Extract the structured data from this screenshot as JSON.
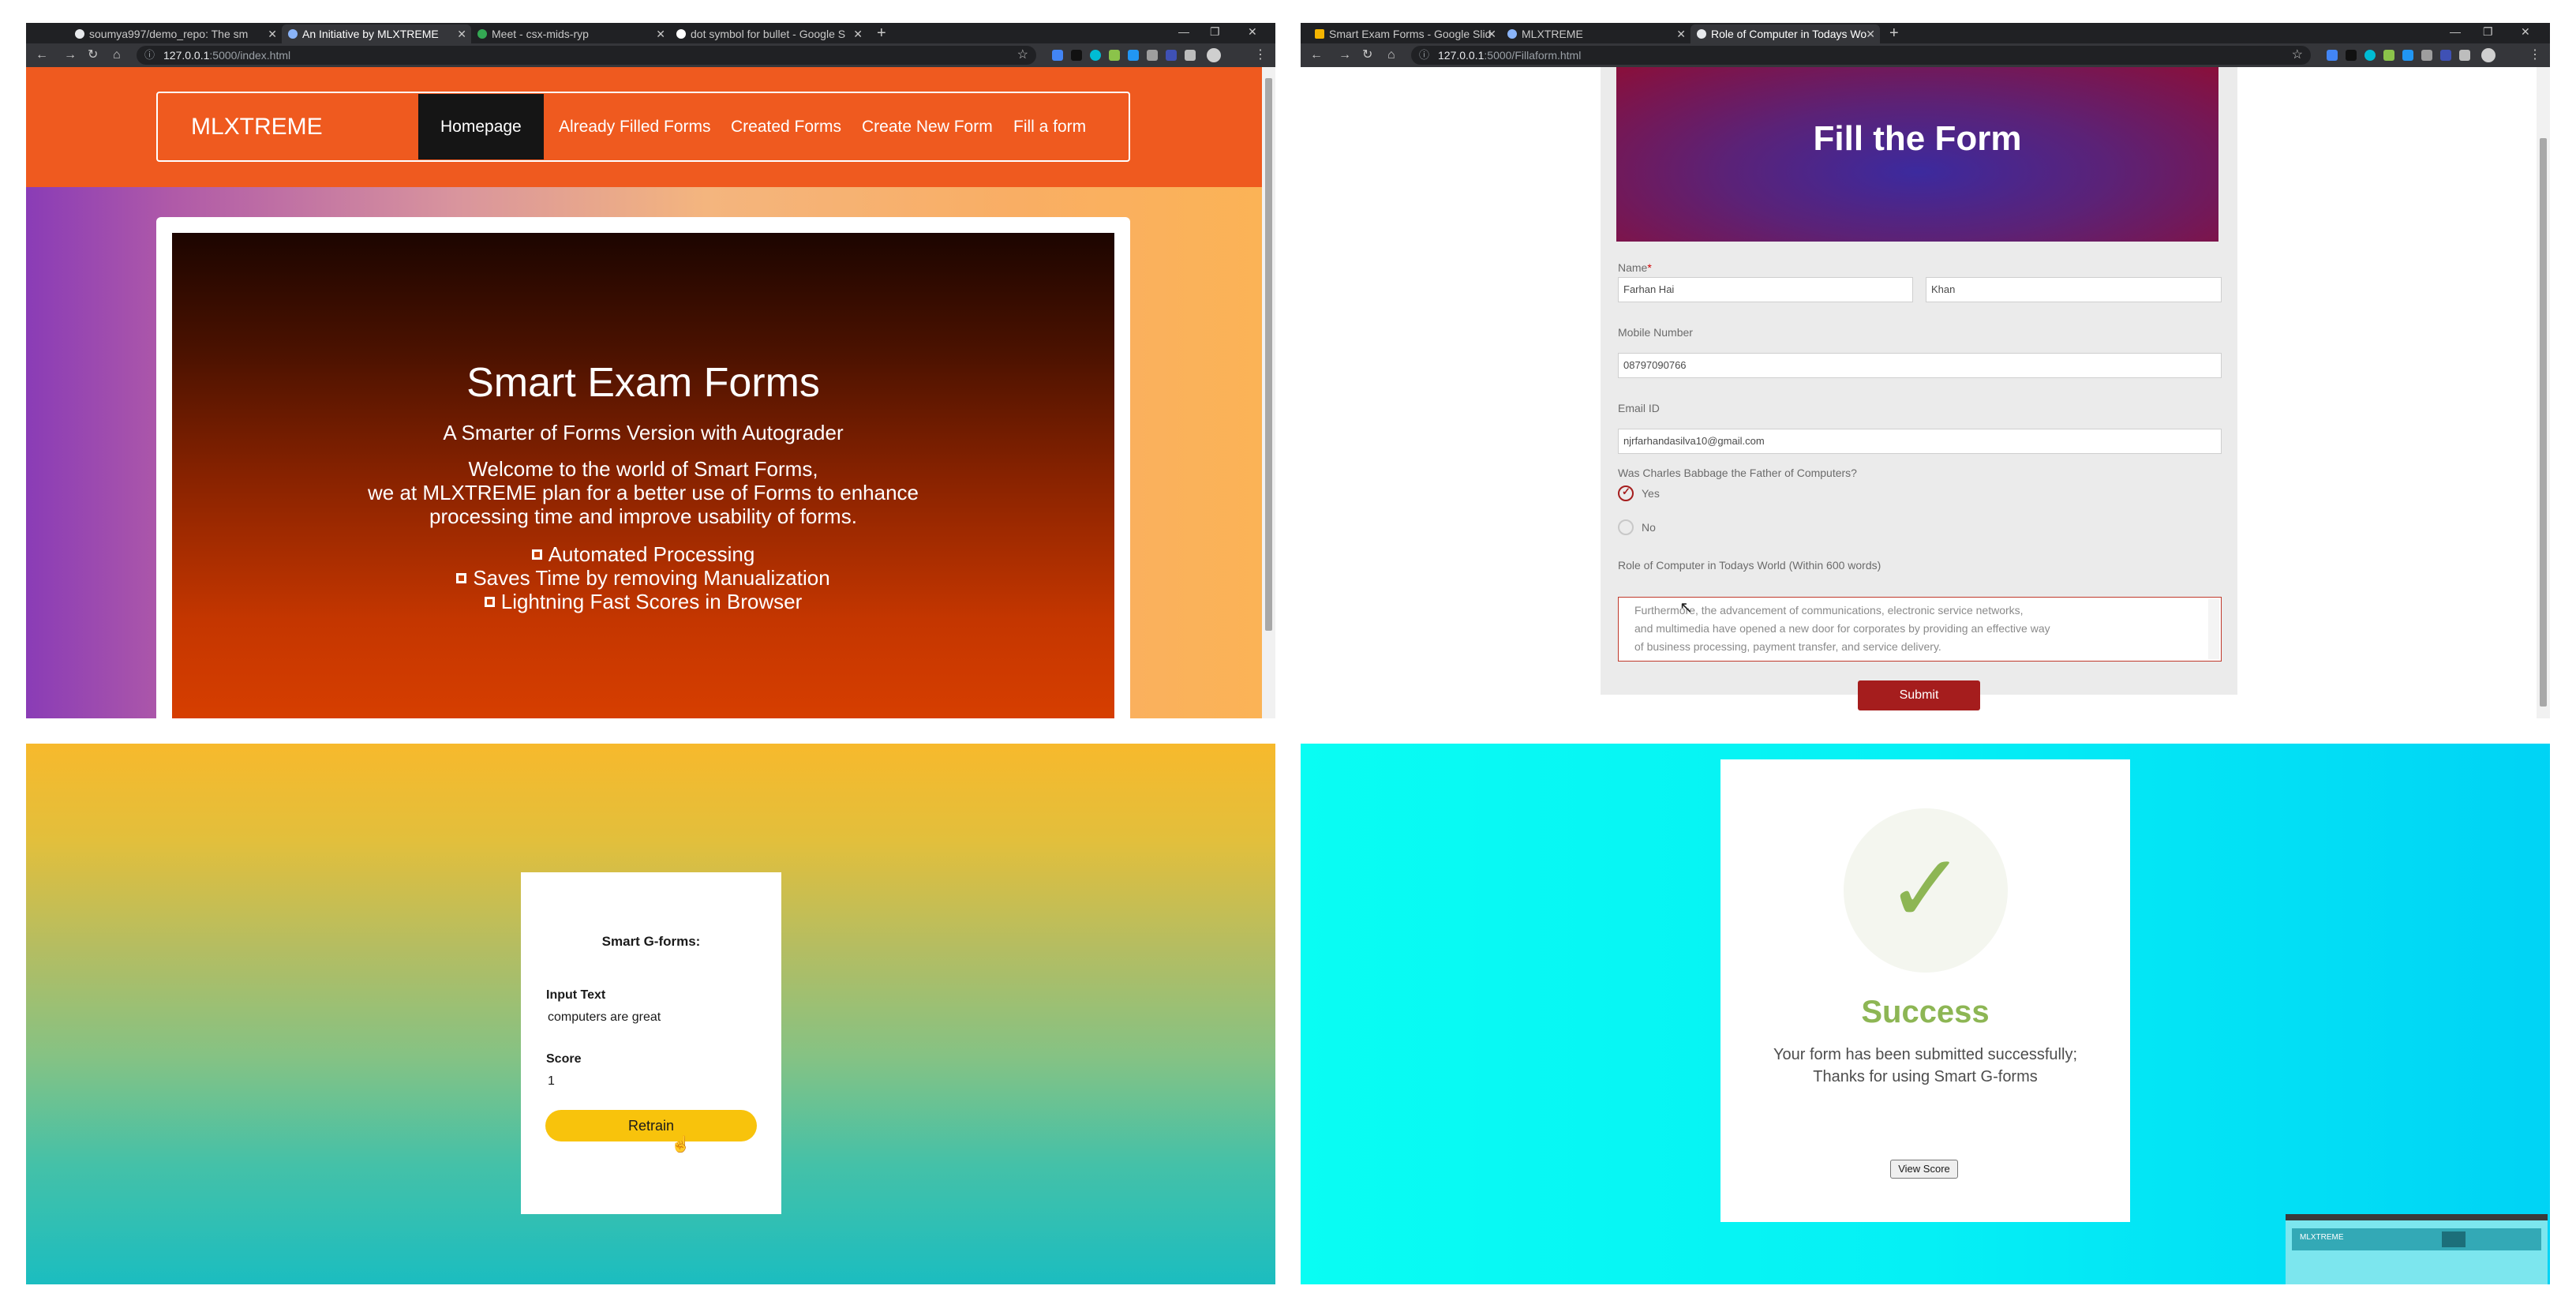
{
  "q1": {
    "tabs": [
      {
        "title": "soumya997/demo_repo: The sm",
        "active": false
      },
      {
        "title": "An Initiative by MLXTREME",
        "active": true
      },
      {
        "title": "Meet - csx-mids-ryp",
        "active": false
      },
      {
        "title": "dot symbol for bullet - Google S",
        "active": false
      }
    ],
    "url_host": "127.0.0.1",
    "url_rest": ":5000/index.html",
    "nav": {
      "brand": "MLXTREME",
      "links": [
        "Homepage",
        "Already Filled Forms",
        "Created Forms",
        "Create New Form",
        "Fill a form"
      ]
    },
    "hero": {
      "title": "Smart Exam Forms",
      "subtitle": "A Smarter of Forms Version with Autograder",
      "desc": [
        "Welcome to the world of Smart Forms,",
        "we at MLXTREME plan for a better use of Forms to enhance",
        "processing time and improve usability of forms."
      ],
      "features": [
        "Automated Processing",
        "Saves Time by removing Manualization",
        "Lightning Fast Scores in Browser"
      ]
    }
  },
  "q2": {
    "tabs": [
      {
        "title": "Smart Exam Forms - Google Slid",
        "active": false
      },
      {
        "title": "MLXTREME",
        "active": false
      },
      {
        "title": "Role of Computer in Todays Wo",
        "active": true
      }
    ],
    "url_host": "127.0.0.1",
    "url_rest": ":5000/Fillaform.html",
    "form": {
      "title": "Fill the Form",
      "name_label": "Name",
      "required_mark": "*",
      "first_name": "Farhan Hai",
      "last_name": "Khan",
      "mobile_label": "Mobile Number",
      "mobile": "08797090766",
      "email_label": "Email ID",
      "email": "njrfarhandasilva10@gmail.com",
      "question": "Was Charles Babbage the Father of Computers?",
      "option_yes": "Yes",
      "option_no": "No",
      "essay_label": "Role of Computer in Todays World (Within 600 words)",
      "essay_lines": [
        "Furthermore, the advancement of communications, electronic service networks,",
        "and multimedia have opened a new door for corporates by providing an effective way",
        "of business processing, payment transfer, and service delivery."
      ],
      "submit": "Submit"
    }
  },
  "q3": {
    "title": "Smart G-forms:",
    "input_label": "Input Text",
    "input_value": "computers are great",
    "score_label": "Score",
    "score_value": "1",
    "button": "Retrain"
  },
  "q4": {
    "check": "✓",
    "title": "Success",
    "message": [
      "Your form has been submitted successfully;",
      "Thanks for using Smart G-forms"
    ],
    "button": "View Score",
    "thumb_brand": "MLXTREME"
  },
  "colors": {
    "brand_orange": "#ef5a1f",
    "nav_active": "#151515",
    "form_red": "#a51d1d",
    "success_green": "#8db654",
    "retrain_yellow": "#f8c30c"
  }
}
